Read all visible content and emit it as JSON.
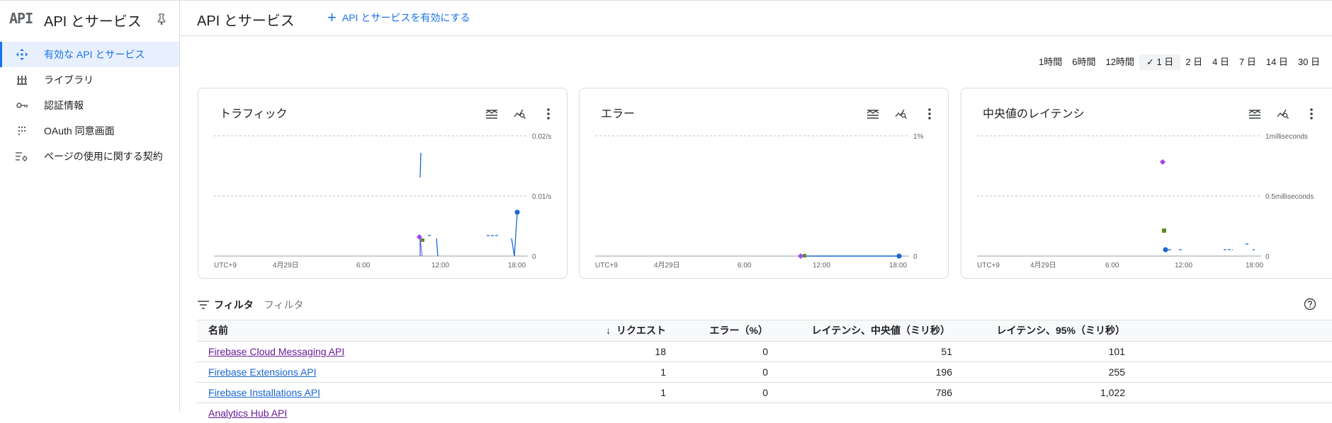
{
  "sidebar": {
    "logo": "API",
    "title": "API とサービス",
    "items": [
      {
        "label": "有効な API とサービス",
        "icon": "apis-icon",
        "active": true
      },
      {
        "label": "ライブラリ",
        "icon": "library-icon",
        "active": false
      },
      {
        "label": "認証情報",
        "icon": "key-icon",
        "active": false
      },
      {
        "label": "OAuth 同意画面",
        "icon": "oauth-consent-icon",
        "active": false
      },
      {
        "label": "ページの使用に関する契約",
        "icon": "agreements-icon",
        "active": false
      }
    ]
  },
  "header": {
    "title": "API とサービス",
    "enable_label": "API とサービスを有効にする"
  },
  "time_range": {
    "options": [
      "1時間",
      "6時間",
      "12時間",
      "1 日",
      "2 日",
      "4 日",
      "7 日",
      "14 日",
      "30 日"
    ],
    "selected": "1 日"
  },
  "cards": [
    {
      "title": "トラフィック",
      "y_ticks": [
        "0.02/s",
        "0.01/s",
        "0"
      ],
      "x_ticks": [
        "UTC+9",
        "4月29日",
        "6:00",
        "12:00",
        "18:00"
      ]
    },
    {
      "title": "エラー",
      "y_ticks": [
        "1%",
        "0"
      ],
      "x_ticks": [
        "UTC+9",
        "4月29日",
        "6:00",
        "12:00",
        "18:00"
      ]
    },
    {
      "title": "中央値のレイテンシ",
      "y_ticks": [
        "1milliseconds",
        "0.5milliseconds",
        "0"
      ],
      "x_ticks": [
        "UTC+9",
        "4月29日",
        "6:00",
        "12:00",
        "18:00"
      ]
    }
  ],
  "colors": {
    "accent": "#1a73e8",
    "series_blue": "#1967d2",
    "series_purple": "#a142f4",
    "series_green": "#5b8f2e"
  },
  "filter": {
    "label": "フィルタ",
    "placeholder": "フィルタ"
  },
  "table": {
    "columns": [
      "名前",
      "リクエスト",
      "エラー（%）",
      "レイテンシ、中央値（ミリ秒）",
      "レイテンシ、95%（ミリ秒）"
    ],
    "rows": [
      {
        "name": "Firebase Cloud Messaging API",
        "requests": "18",
        "errors": "0",
        "latency_median": "51",
        "latency_p95": "101"
      },
      {
        "name": "Firebase Extensions API",
        "requests": "1",
        "errors": "0",
        "latency_median": "196",
        "latency_p95": "255"
      },
      {
        "name": "Firebase Installations API",
        "requests": "1",
        "errors": "0",
        "latency_median": "786",
        "latency_p95": "1,022"
      },
      {
        "name": "Analytics Hub API",
        "requests": "",
        "errors": "",
        "latency_median": "",
        "latency_p95": ""
      }
    ]
  }
}
